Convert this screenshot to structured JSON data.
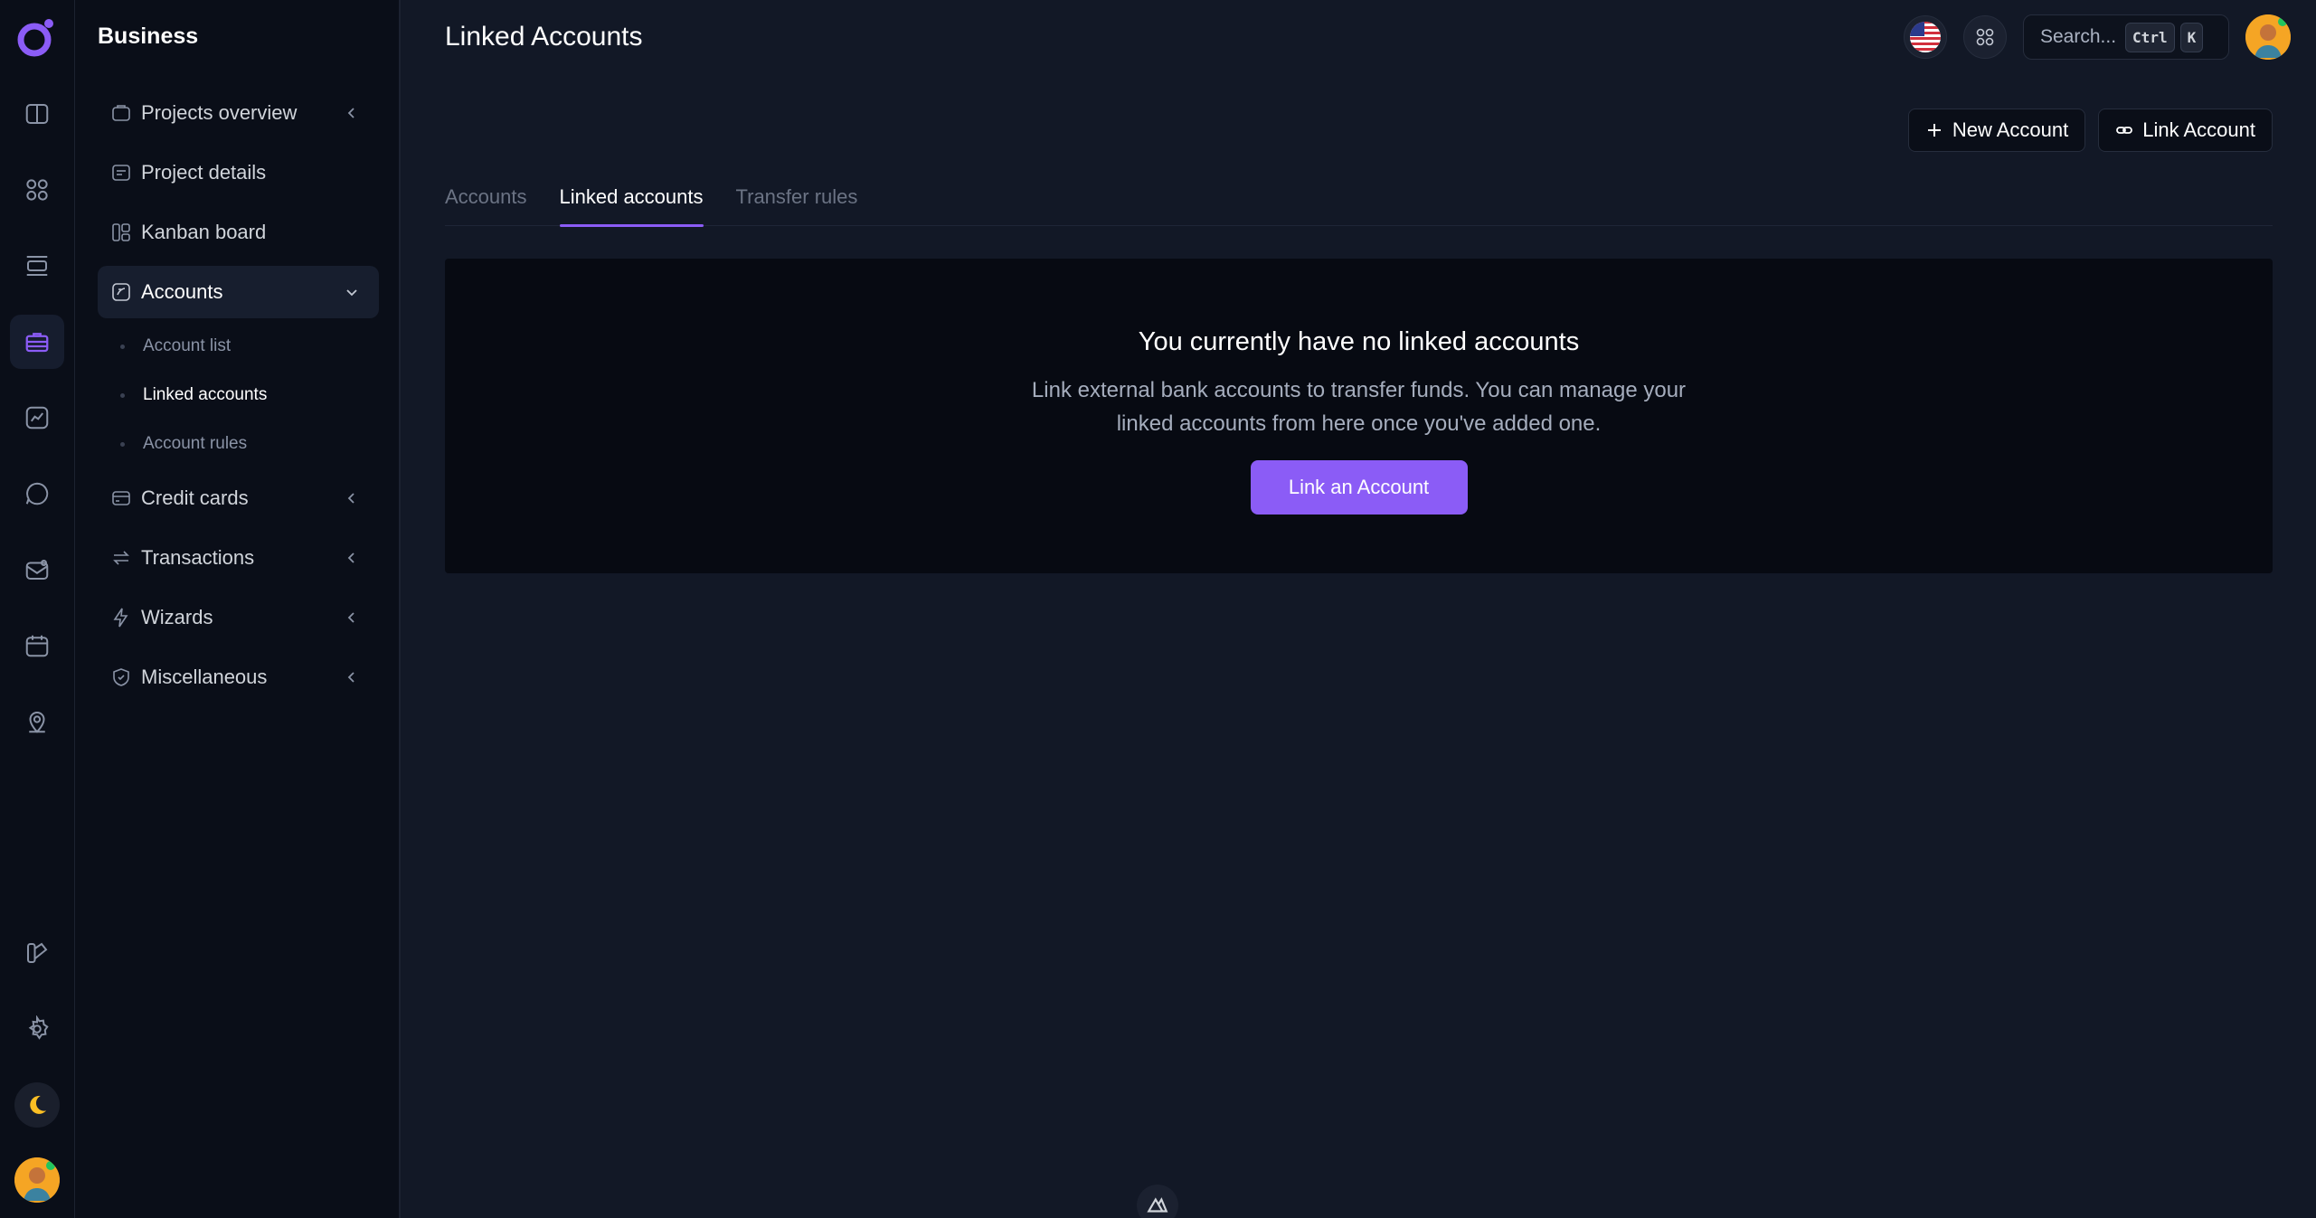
{
  "sidebar": {
    "title": "Business",
    "items": [
      {
        "label": "Projects overview"
      },
      {
        "label": "Project details"
      },
      {
        "label": "Kanban board"
      },
      {
        "label": "Accounts"
      },
      {
        "label": "Credit cards"
      },
      {
        "label": "Transactions"
      },
      {
        "label": "Wizards"
      },
      {
        "label": "Miscellaneous"
      }
    ],
    "accounts_sub": [
      {
        "label": "Account list"
      },
      {
        "label": "Linked accounts"
      },
      {
        "label": "Account rules"
      }
    ]
  },
  "header": {
    "title": "Linked Accounts",
    "search_placeholder": "Search...",
    "kbd_ctrl": "Ctrl",
    "kbd_k": "K"
  },
  "actions": {
    "new_account": "New Account",
    "link_account": "Link Account"
  },
  "tabs": [
    {
      "label": "Accounts"
    },
    {
      "label": "Linked accounts"
    },
    {
      "label": "Transfer rules"
    }
  ],
  "empty_state": {
    "title": "You currently have no linked accounts",
    "description": "Link external bank accounts to transfer funds. You can manage your linked accounts from here once you've added one.",
    "button": "Link an Account"
  },
  "colors": {
    "accent": "#8b5cf6",
    "background": "#121826",
    "sidebar": "#0a0e18"
  },
  "icons": {
    "logo": "app-logo-icon",
    "language": "us-flag-icon",
    "apps": "grid-icon"
  }
}
